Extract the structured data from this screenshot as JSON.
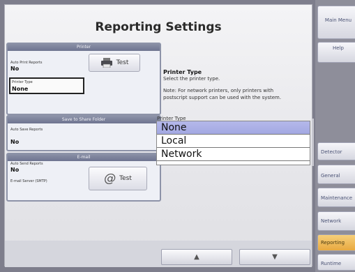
{
  "title": "Reporting Settings",
  "printer_group": {
    "header": "Printer",
    "auto_print_label": "Auto Print Reports",
    "auto_print_value": "No",
    "test_label": "Test",
    "printer_type_label": "Printer Type",
    "printer_type_value": "None"
  },
  "share_group": {
    "header": "Save to Share Folder",
    "auto_save_label": "Auto Save Reports",
    "auto_save_value": "No"
  },
  "email_group": {
    "header": "E-mail",
    "auto_send_label": "Auto Send Reports",
    "auto_send_value": "No",
    "smtp_label": "E-mail Server (SMTP)",
    "test_label": "Test",
    "at_symbol": "@"
  },
  "info": {
    "title": "Printer Type",
    "line1": "Select the printer type.",
    "note1": "Note: For network printers, only printers with",
    "note2": "postscript support can be used with the system."
  },
  "list": {
    "label": "Printer Type",
    "items": [
      "None",
      "Local",
      "Network"
    ],
    "selected": "None"
  },
  "scroll": {
    "up_glyph": "▲",
    "down_glyph": "▼"
  },
  "nav": {
    "main_menu": "Main Menu",
    "help": "Help",
    "detector": "Detector",
    "general": "General",
    "maintenance": "Maintenance",
    "network": "Network",
    "reporting": "Reporting",
    "runtime": "Runtime"
  },
  "colors": {
    "active_tab": "#e8a940",
    "selected_item": "#a3a8e2"
  }
}
